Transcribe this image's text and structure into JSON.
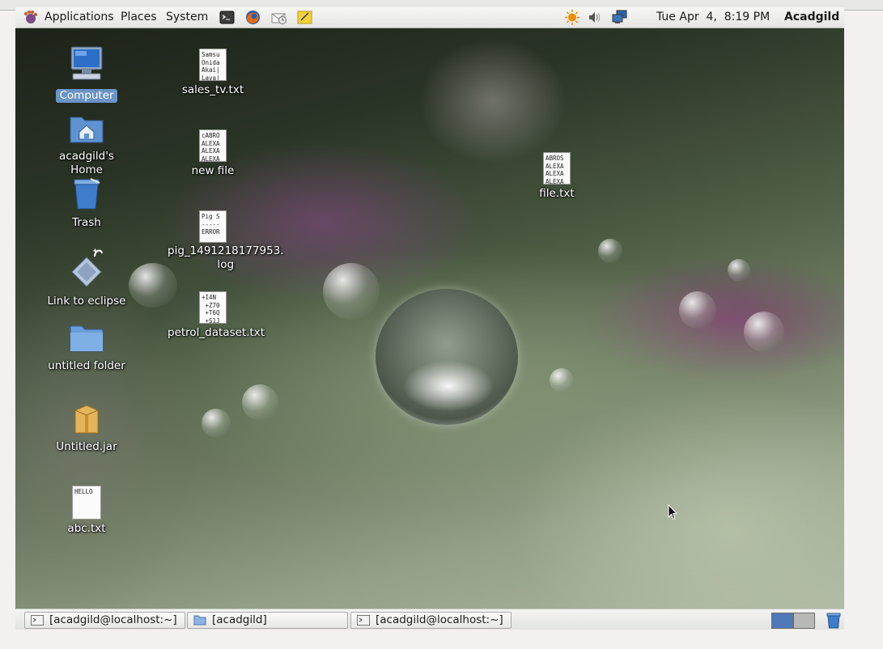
{
  "panel": {
    "menus": [
      "Applications",
      "Places",
      "System"
    ],
    "clock": "Tue Apr  4,  8:19 PM",
    "user": "Acadgild",
    "launchers": [
      "terminal-icon",
      "firefox-icon",
      "mail-icon",
      "notes-icon"
    ],
    "tray": [
      "weather-sun-icon",
      "volume-icon",
      "network-icon"
    ]
  },
  "desktop": {
    "icons": [
      {
        "label": "Computer",
        "icon": "computer-icon",
        "selected": true
      },
      {
        "label": "acadgild's Home",
        "icon": "home-folder-icon"
      },
      {
        "label": "Trash",
        "icon": "trash-icon"
      },
      {
        "label": "Link to eclipse",
        "icon": "eclipse-link-icon"
      },
      {
        "label": "untitled folder",
        "icon": "folder-icon"
      },
      {
        "label": "Untitled.jar",
        "icon": "jar-archive-icon"
      },
      {
        "label": "abc.txt",
        "icon": "text-file-icon",
        "preview": "HELLO"
      },
      {
        "label": "sales_tv.txt",
        "icon": "text-file-icon",
        "preview": "Samsu\nOnida\nAkai|\nLava|"
      },
      {
        "label": "new file",
        "icon": "text-file-icon",
        "preview": "cABRO\nALEXA\nALEXA\nALEXA"
      },
      {
        "label": "pig_1491218177953.\nlog",
        "icon": "text-file-icon",
        "preview": "Pig S\n-----\nERROR"
      },
      {
        "label": "petrol_dataset.txt",
        "icon": "text-file-icon",
        "preview": "+I4N\n +Z70\n +T6Q\n +S1J"
      },
      {
        "label": "file.txt",
        "icon": "text-file-icon",
        "preview": "ABROS\nALEXA\nALEXA\nALEXA"
      }
    ]
  },
  "taskbar": {
    "windows": [
      {
        "label": "[acadgild@localhost:~]",
        "icon": "terminal-icon"
      },
      {
        "label": "[acadgild]",
        "icon": "folder-icon"
      },
      {
        "label": "[acadgild@localhost:~]",
        "icon": "terminal-icon"
      }
    ],
    "colors": {
      "workspace_active": "#4f79b8",
      "workspace_inactive": "#b8b8b6",
      "selection": "#6a93c7"
    }
  }
}
